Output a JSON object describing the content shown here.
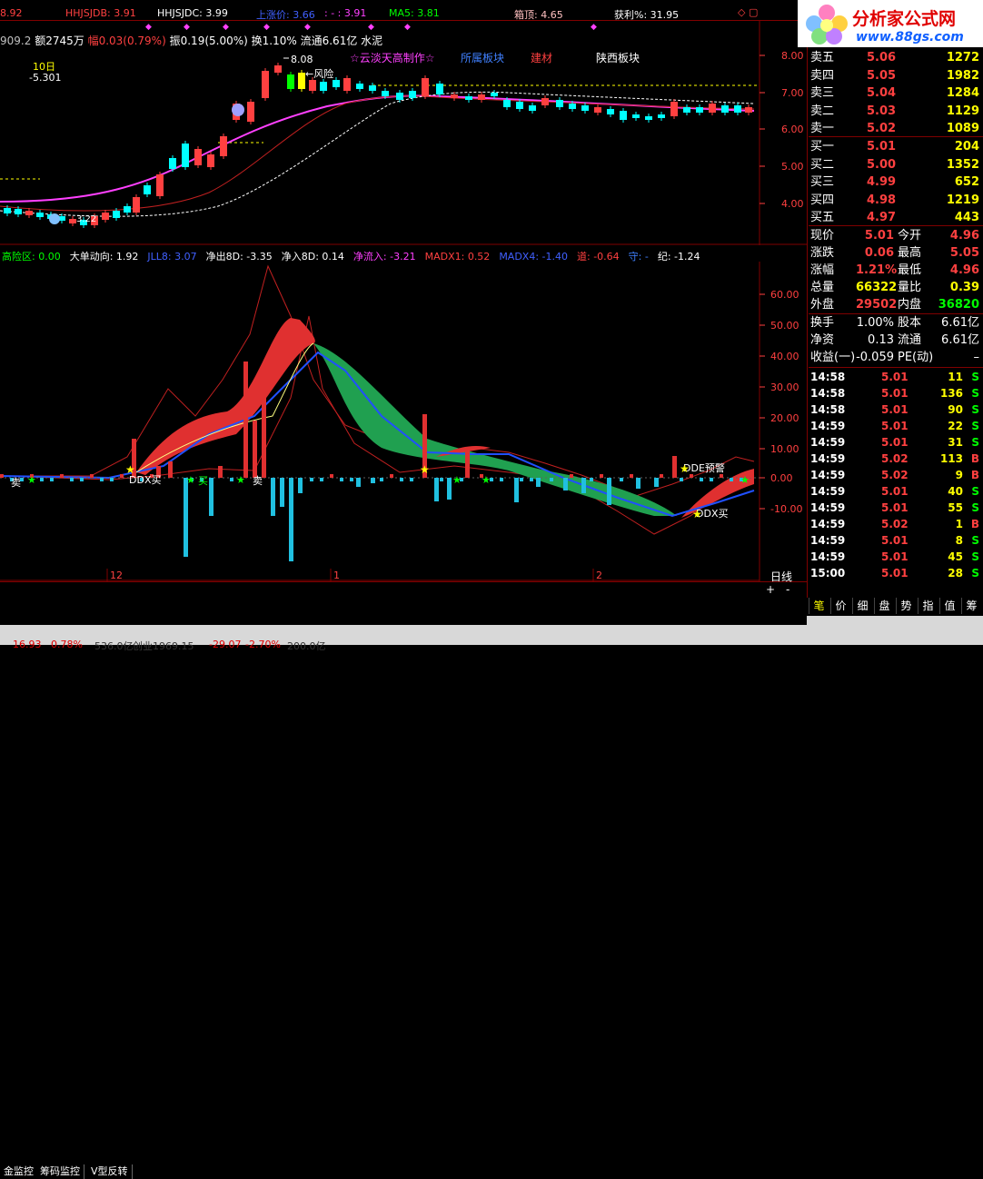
{
  "header": {
    "price_val": "8.92",
    "hhjsjdb_label": "HHJSJDB: 3.91",
    "hhjsjdc_label": "HHJSJDC: 3.99",
    "up_price_label": "上涨价: 3.66",
    "dash_label": ": - : 3.91",
    "ma5_label": "MA5: 3.81",
    "box_top_label": "箱顶: 4.65",
    "profit_label": "获利%: 31.95",
    "logo_text": "分析家公式网",
    "logo_url": "www.88gs.com"
  },
  "info_line": {
    "volume": "909.2",
    "amount": "额2745万",
    "amplitude_pct": "幅0.03(0.79%)",
    "swing": "振0.19(5.00%)",
    "turnover": "换1.10%",
    "float_cap": "流通6.61亿",
    "sector": "水泥"
  },
  "upper_chart": {
    "ten_day_label": "10日",
    "ten_day_value": "-5.301",
    "peak_label": "8.08",
    "risk_label": "←风险",
    "star_label": "☆云淡天高制作☆",
    "sector1": "所属板块",
    "sector2": "建材",
    "sector3": "陕西板块",
    "y_ticks": [
      "8.00",
      "7.00",
      "6.00",
      "5.00",
      "4.00"
    ],
    "low_label": "3.22"
  },
  "lower_chart": {
    "indicators": [
      {
        "text": "高险区: 0.00",
        "color": "#00ff00"
      },
      {
        "text": "大单动向: 1.92",
        "color": "#ffffff"
      },
      {
        "text": "JLL8: 3.07",
        "color": "#4060ff"
      },
      {
        "text": "净出8D: -3.35",
        "color": "#ffffff"
      },
      {
        "text": "净入8D: 0.14",
        "color": "#ffffff"
      },
      {
        "text": "净流入: -3.21",
        "color": "#ff40ff"
      },
      {
        "text": "MADX1: 0.52",
        "color": "#ff4040"
      },
      {
        "text": "MADX4: -1.40",
        "color": "#4060ff"
      },
      {
        "text": "道: -0.64",
        "color": "#ff4040"
      },
      {
        "text": "守: -",
        "color": "#4080ff"
      },
      {
        "text": "纪: -1.24",
        "color": "#ffffff"
      }
    ],
    "y_ticks": [
      "60.00",
      "50.00",
      "40.00",
      "30.00",
      "20.00",
      "10.00",
      "0.00",
      "-10.00"
    ],
    "labels": {
      "ddx_buy1": "DDX买",
      "ddx_buy2": "DDX买",
      "dde_alert": "DDE预警",
      "buy": "买",
      "sell": "卖",
      "sell2": "卖"
    },
    "x_ticks": [
      "12",
      "1",
      "2"
    ]
  },
  "bottom_tabs": {
    "tabs": [
      "金监控",
      "筹码监控",
      "V型反转"
    ],
    "period": "日线",
    "plus": "+",
    "minus": "-"
  },
  "order_book": {
    "asks": [
      {
        "label": "卖五",
        "price": "5.06",
        "vol": "1272"
      },
      {
        "label": "卖四",
        "price": "5.05",
        "vol": "1982"
      },
      {
        "label": "卖三",
        "price": "5.04",
        "vol": "1284"
      },
      {
        "label": "卖二",
        "price": "5.03",
        "vol": "1129"
      },
      {
        "label": "卖一",
        "price": "5.02",
        "vol": "1089"
      }
    ],
    "bids": [
      {
        "label": "买一",
        "price": "5.01",
        "vol": "204"
      },
      {
        "label": "买二",
        "price": "5.00",
        "vol": "1352"
      },
      {
        "label": "买三",
        "price": "4.99",
        "vol": "652"
      },
      {
        "label": "买四",
        "price": "4.98",
        "vol": "1219"
      },
      {
        "label": "买五",
        "price": "4.97",
        "vol": "443"
      }
    ]
  },
  "quote": [
    {
      "l1": "现价",
      "v1": "5.01",
      "c1": "#ff4040",
      "l2": "今开",
      "v2": "4.96",
      "c2": "#ff4040"
    },
    {
      "l1": "涨跌",
      "v1": "0.06",
      "c1": "#ff4040",
      "l2": "最高",
      "v2": "5.05",
      "c2": "#ff4040"
    },
    {
      "l1": "涨幅",
      "v1": "1.21%",
      "c1": "#ff4040",
      "l2": "最低",
      "v2": "4.96",
      "c2": "#ff4040"
    },
    {
      "l1": "总量",
      "v1": "66322",
      "c1": "#ffff00",
      "l2": "量比",
      "v2": "0.39",
      "c2": "#ffff00"
    },
    {
      "l1": "外盘",
      "v1": "29502",
      "c1": "#ff4040",
      "l2": "内盘",
      "v2": "36820",
      "c2": "#00ff00"
    }
  ],
  "fundamentals": [
    {
      "l1": "换手",
      "v1": "1.00%",
      "l2": "股本",
      "v2": "6.61亿"
    },
    {
      "l1": "净资",
      "v1": "0.13",
      "l2": "流通",
      "v2": "6.61亿"
    },
    {
      "l1": "收益(一)",
      "v1": "-0.059",
      "l2": "PE(动)",
      "v2": "–"
    }
  ],
  "ticks": [
    {
      "time": "14:58",
      "price": "5.01",
      "vol": "11",
      "side": "S"
    },
    {
      "time": "14:58",
      "price": "5.01",
      "vol": "136",
      "side": "S"
    },
    {
      "time": "14:58",
      "price": "5.01",
      "vol": "90",
      "side": "S"
    },
    {
      "time": "14:59",
      "price": "5.01",
      "vol": "22",
      "side": "S"
    },
    {
      "time": "14:59",
      "price": "5.01",
      "vol": "31",
      "side": "S"
    },
    {
      "time": "14:59",
      "price": "5.02",
      "vol": "113",
      "side": "B"
    },
    {
      "time": "14:59",
      "price": "5.02",
      "vol": "9",
      "side": "B"
    },
    {
      "time": "14:59",
      "price": "5.01",
      "vol": "40",
      "side": "S"
    },
    {
      "time": "14:59",
      "price": "5.01",
      "vol": "55",
      "side": "S"
    },
    {
      "time": "14:59",
      "price": "5.02",
      "vol": "1",
      "side": "B"
    },
    {
      "time": "14:59",
      "price": "5.01",
      "vol": "8",
      "side": "S"
    },
    {
      "time": "14:59",
      "price": "5.01",
      "vol": "45",
      "side": "S"
    },
    {
      "time": "15:00",
      "price": "5.01",
      "vol": "28",
      "side": "S"
    }
  ],
  "side_tabs": [
    "笔",
    "价",
    "细",
    "盘",
    "势",
    "指",
    "值",
    "筹"
  ],
  "status_bar": {
    "t1": "16.93",
    "t2": "0.78%",
    "t3": "536.0亿",
    "t4": "创业1969.15",
    "t5": "-29.07",
    "t6": "-2.70%",
    "t7": "200.0亿"
  },
  "colors": {
    "up": "#ff4040",
    "down": "#00ffff",
    "grid": "#800000",
    "yellow": "#ffff00",
    "magenta": "#ff40ff"
  }
}
